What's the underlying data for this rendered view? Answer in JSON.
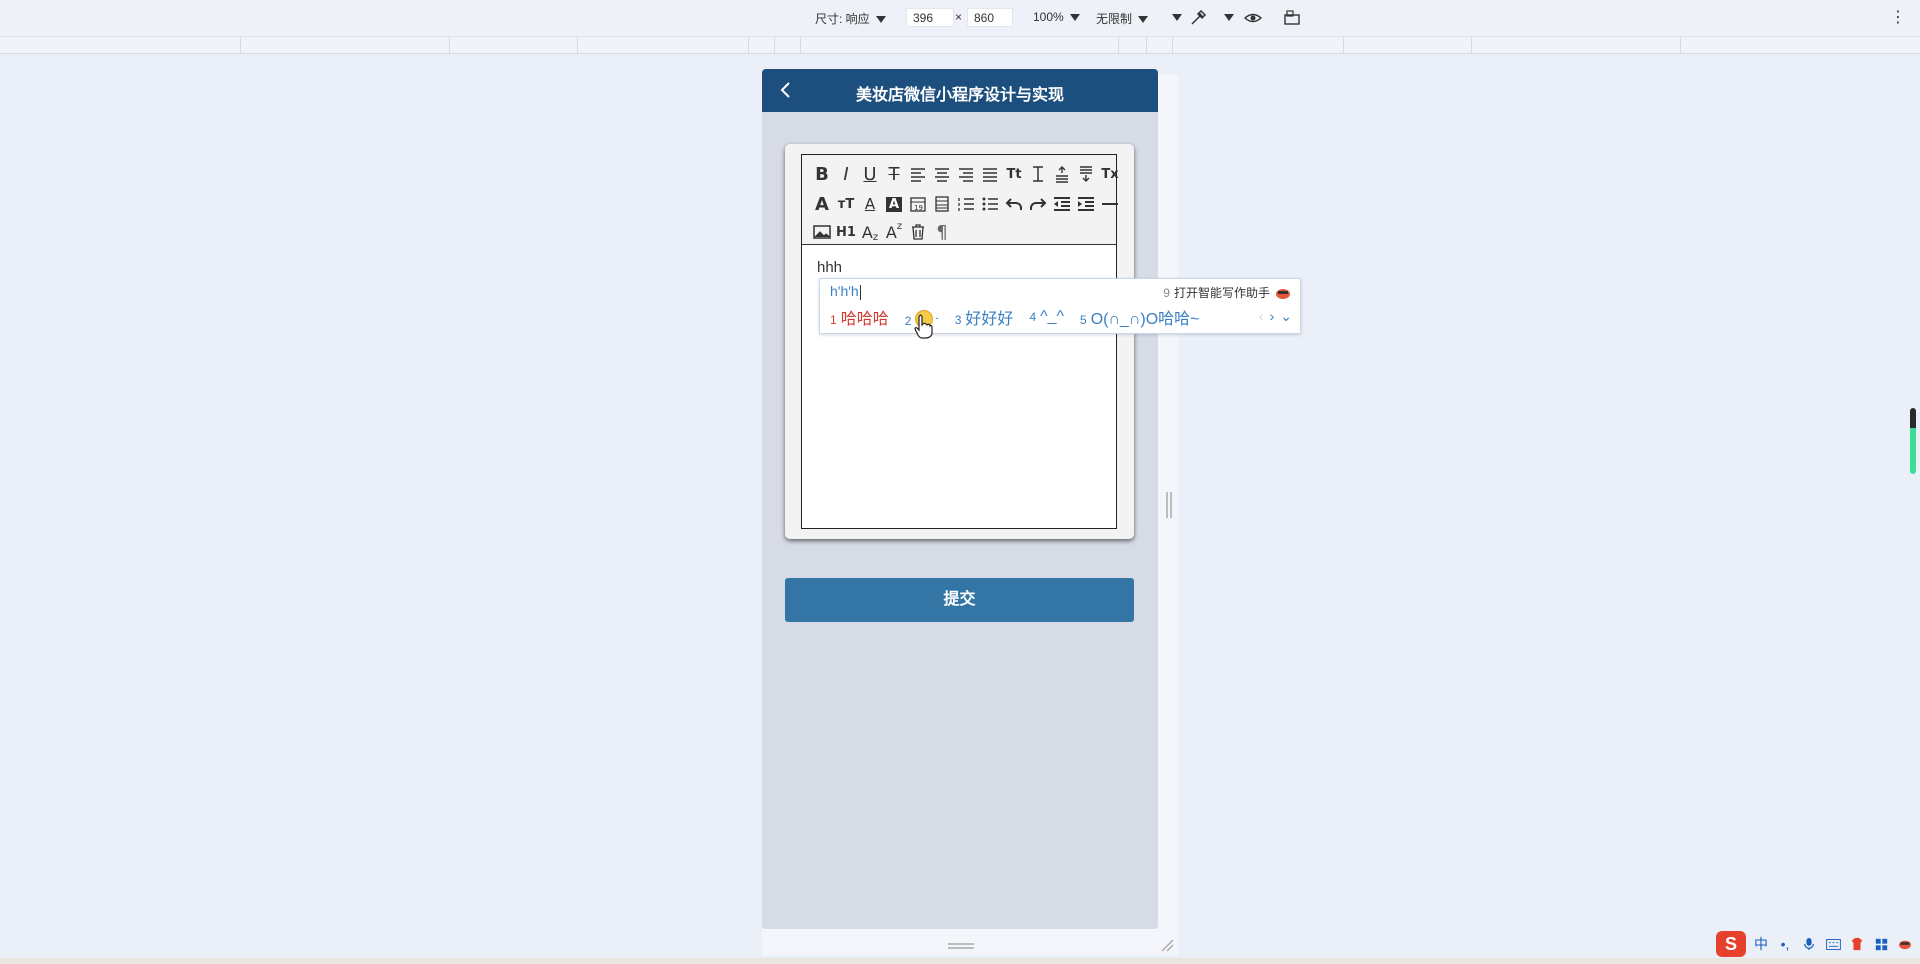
{
  "devtools": {
    "size_label": "尺寸: 响应",
    "width": "396",
    "times": "×",
    "height": "860",
    "zoom": "100%",
    "throttle": "无限制"
  },
  "app": {
    "title": "美妆店微信小程序设计与实现",
    "editor_text": "hhh",
    "submit_label": "提交",
    "toolbar_row1": [
      "B",
      "I",
      "U",
      "S",
      "≡",
      "≡",
      "≡",
      "≡",
      "Tt",
      "⌶",
      "≣",
      "≣",
      "Tx"
    ],
    "toolbar_row2": [
      "A",
      "Tᴛ",
      "A",
      "A",
      "19",
      "▤",
      "☰",
      "☰",
      "↶",
      "↷",
      "⇤",
      "⇥",
      "—"
    ],
    "toolbar_row3_h1": "H1"
  },
  "ime": {
    "typed": "h'h'h",
    "assist_num": "9",
    "assist_label": "打开智能写作助手",
    "candidates": [
      {
        "num": "1",
        "text": "哈哈哈"
      },
      {
        "num": "2",
        "text": ""
      },
      {
        "num": "3",
        "text": "好好好"
      },
      {
        "num": "4",
        "text": "^_^"
      },
      {
        "num": "5",
        "text": "O(∩_∩)O哈哈~"
      }
    ]
  },
  "tray": {
    "logo": "S",
    "lang": "中"
  },
  "colors": {
    "navbar": "#1d4f7e",
    "submit": "#3375a5",
    "candidate_first": "#d8392f",
    "candidate": "#3b7fc4"
  }
}
